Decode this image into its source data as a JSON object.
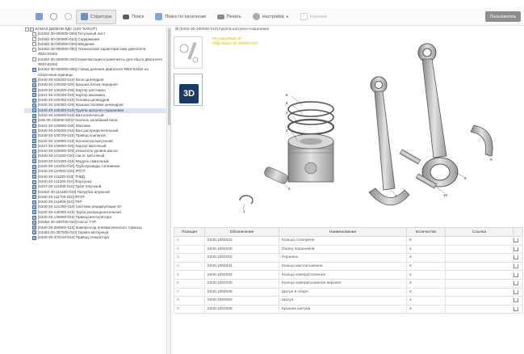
{
  "toolbar": {
    "buttons": [
      {
        "label": "",
        "icon": "list-icon"
      },
      {
        "label": "",
        "icon": "back-icon"
      },
      {
        "label": "",
        "icon": "forward-icon"
      },
      {
        "label": "Структура",
        "icon": "structure-icon"
      },
      {
        "label": "Поиск",
        "icon": "binoculars-icon"
      },
      {
        "label": "Поиск по каталогам",
        "icon": "catalog-search-icon"
      },
      {
        "label": "Печать",
        "icon": "printer-icon"
      },
      {
        "label": "Настройки",
        "icon": "settings-icon"
      },
      {
        "label": "Корзина",
        "icon": "cart-icon"
      }
    ],
    "user_badge": "Пользователь"
  },
  "tree": {
    "root": "КАМАЗ ДИЗЕЛИ КДС (240 \"КАТАЛ\")",
    "items": [
      {
        "text": "[53462-30-000000-000] Титульный лист",
        "type": "doc"
      },
      {
        "text": "[53462-30-000000-010] Содержание",
        "type": "doc"
      },
      {
        "text": "[53462-30-000000-020] Введение",
        "type": "doc"
      },
      {
        "text": "[53462-30-000000-030] Технические характеристики двигателя ЯМЗ-53462",
        "type": "doc"
      },
      {
        "text": "[53462-30-000000-040] Комплектация и комплекты для сбыта двигателя ЯМЗ-53462",
        "type": "doc"
      },
      {
        "text": "[53462-30-000000-050] Схема деления двигателя ЯМЗ-53462 на сборочные единицы",
        "type": "pict"
      },
      {
        "text": "[5340-30-100200-010] Блок цилиндров",
        "type": "pict"
      },
      {
        "text": "[5340-30-100200-020] Крышка блока передняя",
        "type": "pict"
      },
      {
        "text": "[5340-30-100200-030] Картер шестерен",
        "type": "pict"
      },
      {
        "text": "[5341-30-100200-040] Картер маховика",
        "type": "pict"
      },
      {
        "text": "[5340-30-100300-010] Головка цилиндров",
        "type": "pict"
      },
      {
        "text": "[5340-30-100300-020] Крышка головки цилиндров",
        "type": "pict"
      },
      {
        "text": "[5340-30-100400-010] Группа шатунно-поршневая",
        "type": "pict",
        "selected": true
      },
      {
        "text": "[5340-30-100500-010] Вал коленчатый",
        "type": "pict"
      },
      {
        "text": "[536-30-100590-020] Гаситель колебаний вала",
        "type": "pict"
      },
      {
        "text": "[5341-30-100500-030] Маховик",
        "type": "pict"
      },
      {
        "text": "[5340-30-100600-010] Вал распределительный",
        "type": "pict"
      },
      {
        "text": "[5340-30-100700-010] Привод клапанов",
        "type": "pict"
      },
      {
        "text": "[5340-30-100800-010] Коллектор выпускной",
        "type": "pict"
      },
      {
        "text": "[5347-30-100800-020] Картер масляный",
        "type": "pict"
      },
      {
        "text": "[5340-30-100900-020] Указатель уровня масла",
        "type": "pict"
      },
      {
        "text": "[5340-30-101100-010] Насос масляный",
        "type": "pict"
      },
      {
        "text": "[5340-30-101200-010] Модуль смазочный",
        "type": "pict"
      },
      {
        "text": "[5340-30-110400-010] Трубопроводы топливные",
        "type": "pict"
      },
      {
        "text": "[5340-30-110500-010] ФТОТ",
        "type": "pict"
      },
      {
        "text": "[5340-30-111100-010] ТНВД",
        "type": "pict"
      },
      {
        "text": "[5340-30-111200-010] Форсунка",
        "type": "pict"
      },
      {
        "text": "[5347-30-111500-010] Тракт впускной",
        "type": "pict"
      },
      {
        "text": "[53462-30-111500-020] Патрубок впускной",
        "type": "pict"
      },
      {
        "text": "[5340-30-111700-010] ФТОТ",
        "type": "pict"
      },
      {
        "text": "[5340-30-111800-010] ТКР",
        "type": "pict"
      },
      {
        "text": "[5340-30-121300-010] Система рециркуляции ОГ",
        "type": "pict"
      },
      {
        "text": "[5340-30-130300-010] Труба распределительная",
        "type": "pict"
      },
      {
        "text": "[5340-30-130800-010] Привод вентилятора",
        "type": "pict"
      },
      {
        "text": "[53462-30-340700-010] Насос ГУР",
        "type": "pict"
      },
      {
        "text": "[5340-30-350900-010] Компрессор пневматического тормоза",
        "type": "pict"
      },
      {
        "text": "[53462-30-357000-010] Тормоз моторный",
        "type": "pict"
      },
      {
        "text": "[5340-30-370100-010] Привод генератора",
        "type": "pict"
      }
    ]
  },
  "viewer": {
    "breadcrumb": "[5340-30-100400-010] Группа шатунно-поршневая",
    "note_line1": "Регулируемая ОГ",
    "note_line2": "КПД: 53462-30-100400-010",
    "thumb_3d": "3D",
    "callouts": [
      "6",
      "5",
      "4",
      "3",
      "2",
      "1",
      "7",
      "8",
      "9",
      "10"
    ]
  },
  "table": {
    "headers": [
      "Позиция",
      "Обозначение",
      "Наименование",
      "Количество",
      "Ссылка",
      ""
    ],
    "rows": [
      {
        "pos": "1",
        "code": "5340.1004022",
        "name": "Кольцо стопорное",
        "qty": "8"
      },
      {
        "pos": "2",
        "code": "5340.1004020",
        "name": "Палец поршневой",
        "qty": "4"
      },
      {
        "pos": "3",
        "code": "5340.1004015",
        "name": "Поршень",
        "qty": "4"
      },
      {
        "pos": "4",
        "code": "5340.1004034",
        "name": "Кольцо маслосъемное",
        "qty": "4"
      },
      {
        "pos": "5",
        "code": "5340.1004032",
        "name": "Кольцо компрессионное",
        "qty": "4"
      },
      {
        "pos": "6",
        "code": "5340.1004030",
        "name": "Кольцо компрессионное верхнее",
        "qty": "4"
      },
      {
        "pos": "7",
        "code": "5340.1004045",
        "name": "Шатун в сборе",
        "qty": "4"
      },
      {
        "pos": "8",
        "code": "5340.1004050",
        "name": "Шатун",
        "qty": "4"
      },
      {
        "pos": "9",
        "code": "5340.1004055",
        "name": "Крышка шатуна",
        "qty": "4"
      }
    ]
  },
  "colors": {
    "accent": "#5b8fd0",
    "selection": "#d7e5f5",
    "badge": "#8e8e8e",
    "note": "#e0b000"
  }
}
